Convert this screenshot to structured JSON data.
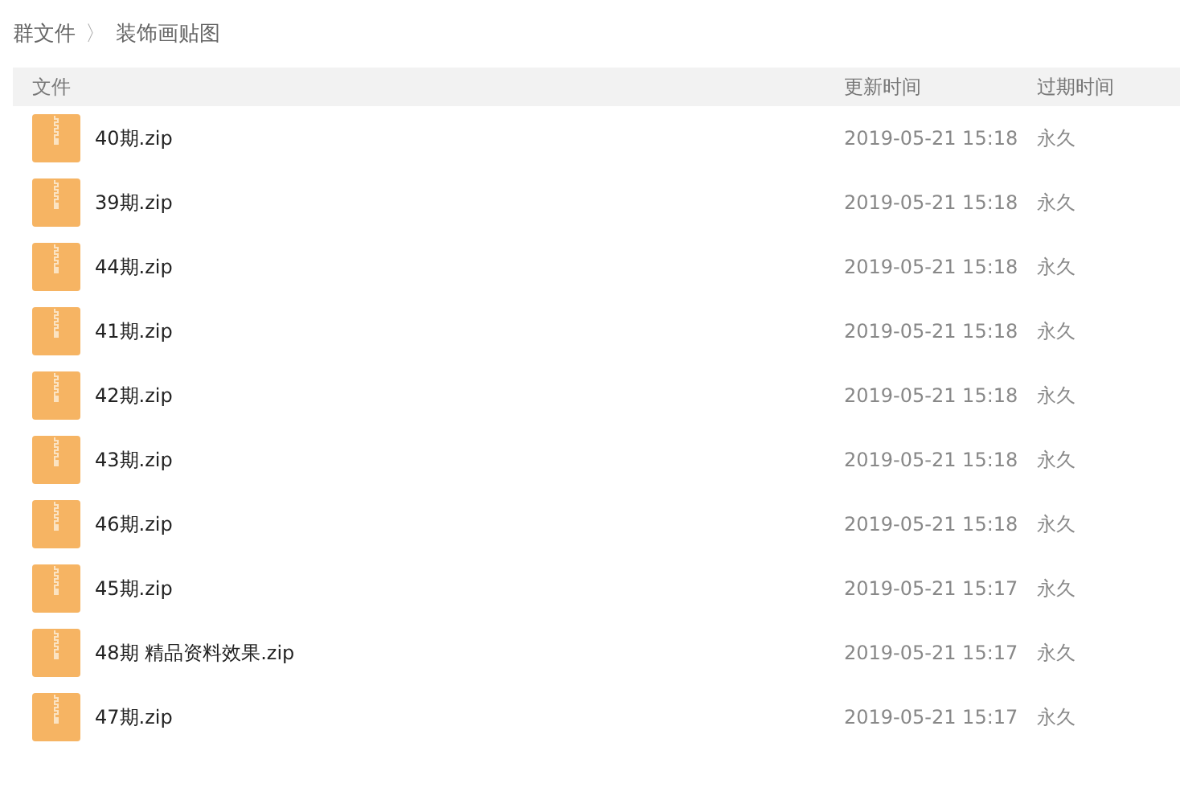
{
  "breadcrumb": {
    "items": [
      "群文件",
      "装饰画贴图"
    ],
    "separator": "〉"
  },
  "table": {
    "columns": [
      "文件",
      "更新时间",
      "过期时间"
    ],
    "rows": [
      {
        "name": "40期.zip",
        "updated": "2019-05-21 15:18",
        "expires": "永久"
      },
      {
        "name": "39期.zip",
        "updated": "2019-05-21 15:18",
        "expires": "永久"
      },
      {
        "name": "44期.zip",
        "updated": "2019-05-21 15:18",
        "expires": "永久"
      },
      {
        "name": "41期.zip",
        "updated": "2019-05-21 15:18",
        "expires": "永久"
      },
      {
        "name": "42期.zip",
        "updated": "2019-05-21 15:18",
        "expires": "永久"
      },
      {
        "name": "43期.zip",
        "updated": "2019-05-21 15:18",
        "expires": "永久"
      },
      {
        "name": "46期.zip",
        "updated": "2019-05-21 15:18",
        "expires": "永久"
      },
      {
        "name": "45期.zip",
        "updated": "2019-05-21 15:17",
        "expires": "永久"
      },
      {
        "name": "48期 精品资料效果.zip",
        "updated": "2019-05-21 15:17",
        "expires": "永久"
      },
      {
        "name": "47期.zip",
        "updated": "2019-05-21 15:17",
        "expires": "永久"
      }
    ]
  }
}
